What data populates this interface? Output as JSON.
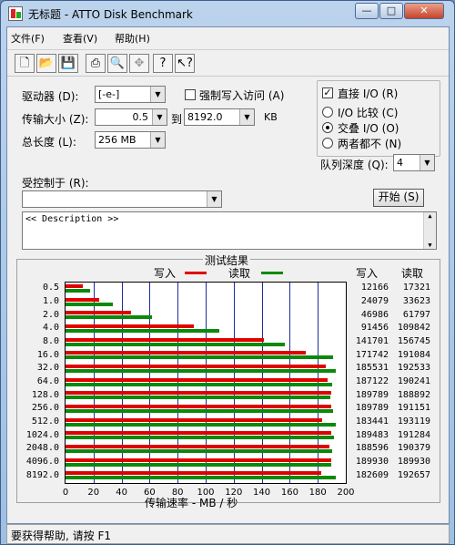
{
  "window": {
    "title": "无标题 - ATTO Disk Benchmark"
  },
  "menu": [
    "文件(F)",
    "查看(V)",
    "帮助(H)"
  ],
  "controls": {
    "drive_label": "驱动器 (D):",
    "drive_value": "[-e-]",
    "force_write_label": "强制写入访问 (A)",
    "transfer_label": "传输大小 (Z):",
    "transfer_from": "0.5",
    "to_label": "到",
    "transfer_to": "8192.0",
    "kb_label": "KB",
    "total_label": "总长度 (L):",
    "total_value": "256 MB",
    "direct_io_label": "直接 I/O (R)",
    "radio_compare": "I/O 比较 (C)",
    "radio_overlap": "交叠 I/O (O)",
    "radio_neither": "两者都不 (N)",
    "queue_label": "队列深度 (Q):",
    "queue_value": "4",
    "controlled_label": "受控制于 (R):",
    "start_button": "开始 (S)",
    "description": "<< Description >>"
  },
  "status": "要获得帮助, 请按 F1",
  "chart_data": {
    "type": "bar",
    "title": "测试结果",
    "legend": {
      "write": "写入",
      "read": "读取"
    },
    "col_headers": {
      "write": "写入",
      "read": "读取"
    },
    "xlabel": "传输速率 - MB / 秒",
    "xlim": [
      0,
      200
    ],
    "xticks": [
      "0",
      "20",
      "40",
      "60",
      "80",
      "100",
      "120",
      "140",
      "160",
      "180",
      "200"
    ],
    "categories": [
      "0.5",
      "1.0",
      "2.0",
      "4.0",
      "8.0",
      "16.0",
      "32.0",
      "64.0",
      "128.0",
      "256.0",
      "512.0",
      "1024.0",
      "2048.0",
      "4096.0",
      "8192.0"
    ],
    "series": [
      {
        "name": "写入",
        "color": "#e00000",
        "values": [
          12166,
          24079,
          46986,
          91456,
          141701,
          171742,
          185531,
          187122,
          189789,
          189789,
          183441,
          189483,
          188596,
          189930,
          182609
        ]
      },
      {
        "name": "读取",
        "color": "#0a8a0a",
        "values": [
          17321,
          33623,
          61797,
          109842,
          156745,
          191084,
          192533,
          190241,
          188892,
          191151,
          193119,
          191284,
          190379,
          189930,
          192657
        ]
      }
    ]
  }
}
